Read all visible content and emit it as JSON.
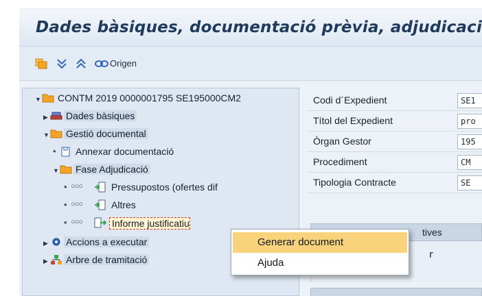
{
  "header": {
    "title": "Dades bàsiques, documentació prèvia, adjudicació,"
  },
  "toolbar": {
    "origin_label": "Origen",
    "buttons": [
      "folder-tool-icon",
      "expand-all-icon",
      "collapse-all-icon",
      "link-icon"
    ]
  },
  "tree": {
    "root": "CONTM 2019 0000001795 SE195000CM2",
    "dades_basiques": "Dades bàsiques",
    "gestio_documental": "Gestió documental",
    "annexar": "Annexar documentació",
    "fase_adjudicacio": "Fase Adjudicació",
    "pressupostos": "Pressupostos (ofertes dif",
    "altres": "Altres",
    "informe": "Informe justificatiu",
    "accions": "Accions a executar",
    "arbre": "Arbre de tramitació",
    "status_circles": "○○○"
  },
  "form": {
    "fields": [
      {
        "label": "Codi d´Expedient",
        "value": "SE1"
      },
      {
        "label": "Títol del Expedient",
        "value": "pro"
      },
      {
        "label": "Òrgan Gestor",
        "value": "195"
      },
      {
        "label": "Procediment",
        "value": "CM"
      },
      {
        "label": "Tipologia Contracte",
        "value": "SE"
      }
    ],
    "section_label": "tives",
    "section_value": "r"
  },
  "context_menu": {
    "items": [
      {
        "label": "Generar document",
        "active": true
      },
      {
        "label": "Ajuda",
        "active": false
      }
    ]
  },
  "colors": {
    "title": "#1f3a5a",
    "menu_highlight": "#f9d37c",
    "folder": "#f3a427"
  }
}
